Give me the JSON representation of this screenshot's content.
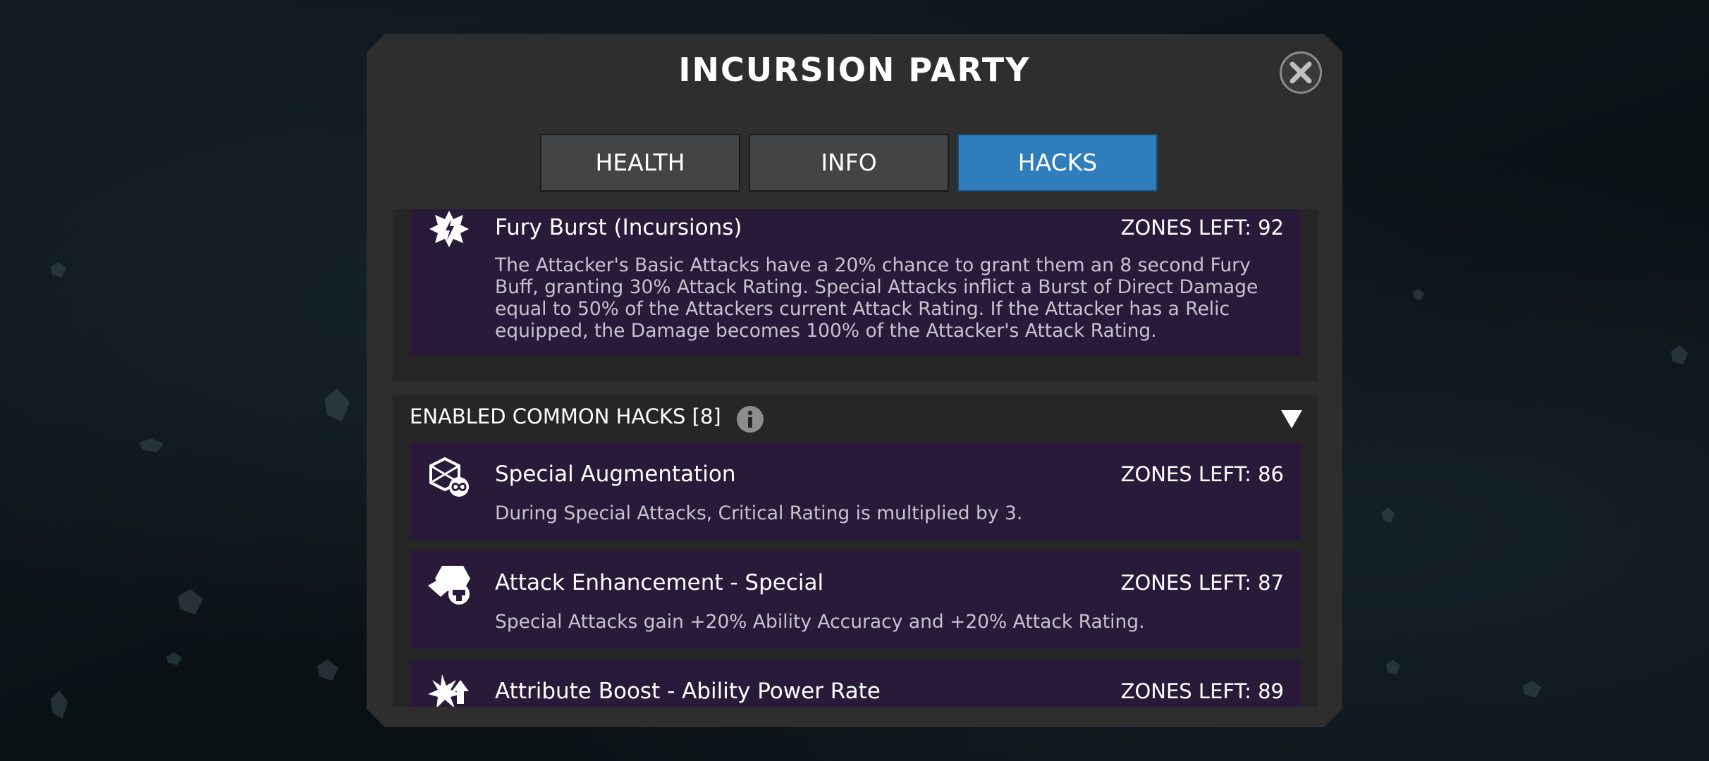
{
  "modal": {
    "title": "INCURSION PARTY",
    "close_icon": "close-icon"
  },
  "tabs": [
    {
      "label": "HEALTH",
      "active": false
    },
    {
      "label": "INFO",
      "active": false
    },
    {
      "label": "HACKS",
      "active": true
    }
  ],
  "featured_hack": {
    "icon": "fury-burst-icon",
    "name": "Fury Burst (Incursions)",
    "zones_left": "ZONES LEFT: 92",
    "description": "The Attacker's Basic Attacks have a 20% chance to grant them an 8 second Fury Buff, granting 30% Attack Rating. Special Attacks inflict a Burst of Direct Damage equal to 50% of the Attackers current Attack Rating. If the Attacker has a Relic equipped, the Damage becomes 100% of the Attacker's Attack Rating."
  },
  "common_hacks": {
    "header": "ENABLED COMMON HACKS [8]",
    "info_icon": "info-icon",
    "collapse_icon": "collapse-triangle-icon",
    "items": [
      {
        "icon": "special-augmentation-icon",
        "name": "Special Augmentation",
        "zones_left": "ZONES LEFT: 86",
        "description": "During Special Attacks, Critical Rating is multiplied by 3."
      },
      {
        "icon": "attack-enhancement-icon",
        "name": "Attack Enhancement - Special",
        "zones_left": "ZONES LEFT: 87",
        "description": "Special Attacks gain +20% Ability Accuracy and +20% Attack Rating."
      },
      {
        "icon": "attribute-boost-icon",
        "name": "Attribute Boost - Ability Power Rate",
        "zones_left": "ZONES LEFT: 89",
        "description": ""
      }
    ]
  },
  "colors": {
    "modal_bg": "#2e2e2f",
    "tab_active": "#2f7dbd",
    "tab_inactive": "#434445",
    "card_bg": "#2a1a3a",
    "section_bg": "#262626"
  }
}
